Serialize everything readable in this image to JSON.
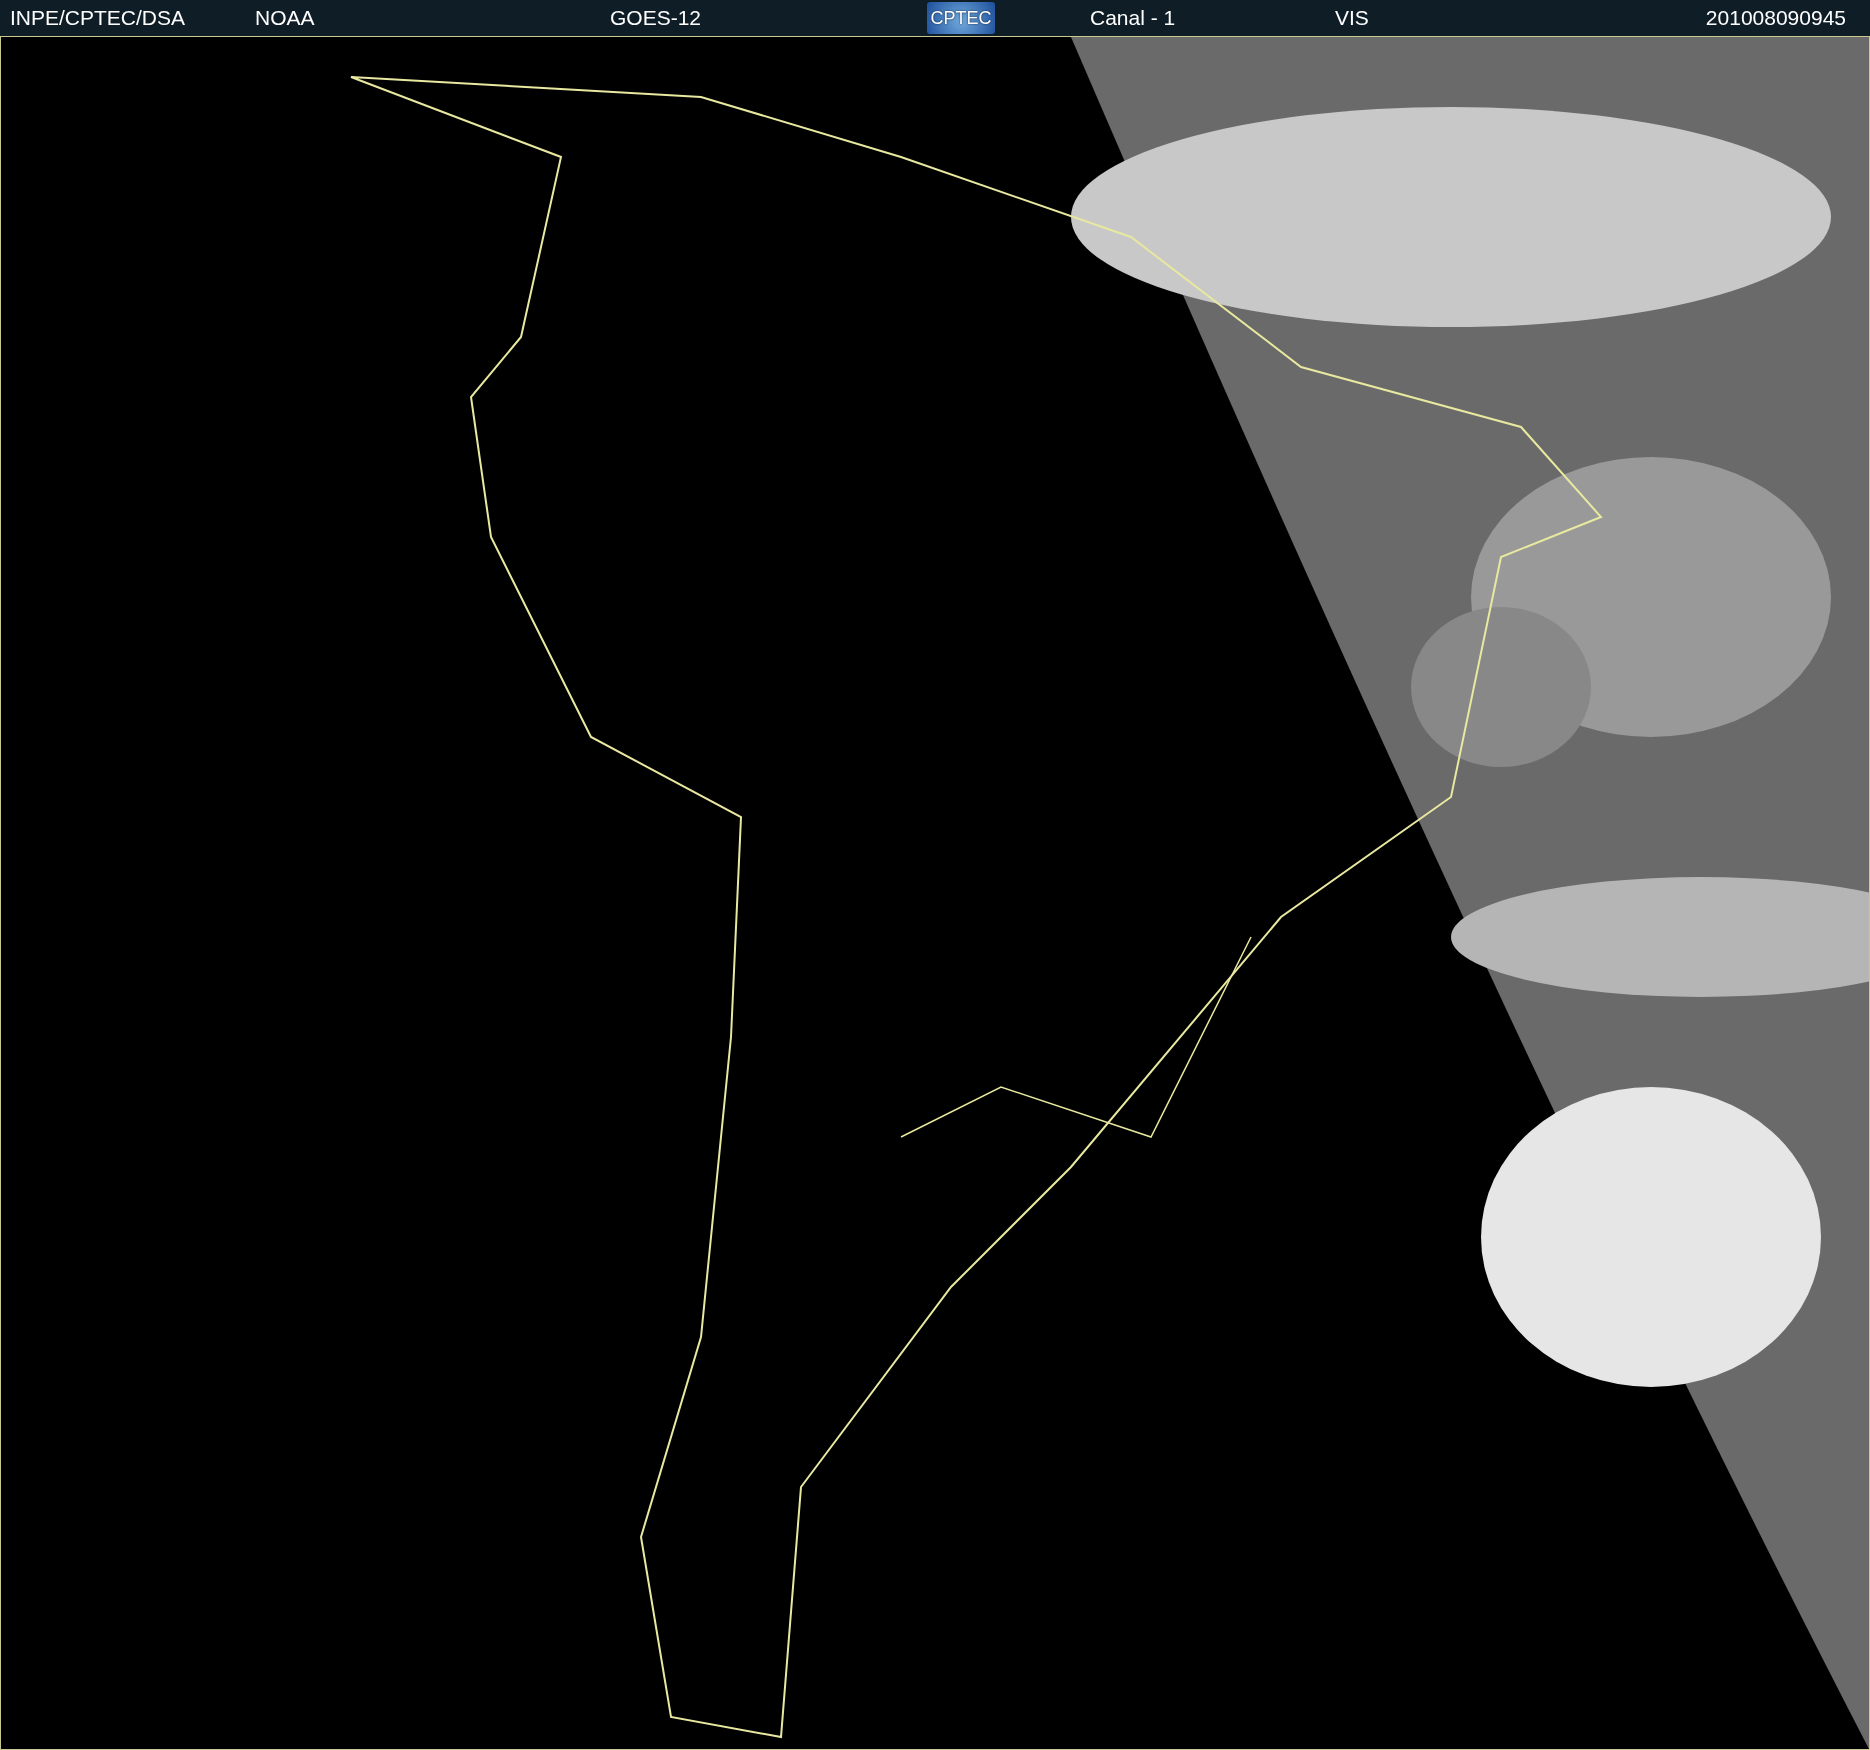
{
  "header": {
    "source": "INPE/CPTEC/DSA",
    "agency": "NOAA",
    "satellite": "GOES-12",
    "logo": "CPTEC",
    "channel": "Canal - 1",
    "band": "VIS",
    "timestamp": "201008090945"
  }
}
